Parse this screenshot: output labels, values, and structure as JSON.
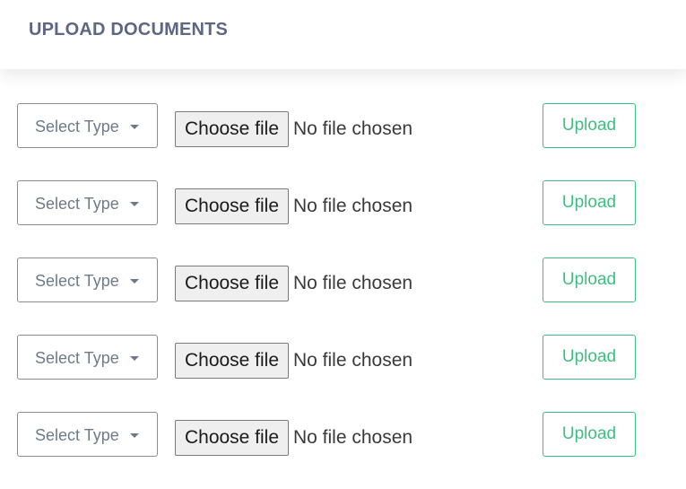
{
  "header": {
    "title": "UPLOAD DOCUMENTS"
  },
  "colors": {
    "title": "#5c6783",
    "accent": "#3fbf7f",
    "select_text": "#6c7a89",
    "border": "#8c8c8c"
  },
  "icons": {
    "select_caret": "caret-down-icon"
  },
  "rows": [
    {
      "select_label": "Select Type",
      "choose_label": "Choose file",
      "file_status": "No file chosen",
      "upload_label": "Upload"
    },
    {
      "select_label": "Select Type",
      "choose_label": "Choose file",
      "file_status": "No file chosen",
      "upload_label": "Upload"
    },
    {
      "select_label": "Select Type",
      "choose_label": "Choose file",
      "file_status": "No file chosen",
      "upload_label": "Upload"
    },
    {
      "select_label": "Select Type",
      "choose_label": "Choose file",
      "file_status": "No file chosen",
      "upload_label": "Upload"
    },
    {
      "select_label": "Select Type",
      "choose_label": "Choose file",
      "file_status": "No file chosen",
      "upload_label": "Upload"
    }
  ]
}
